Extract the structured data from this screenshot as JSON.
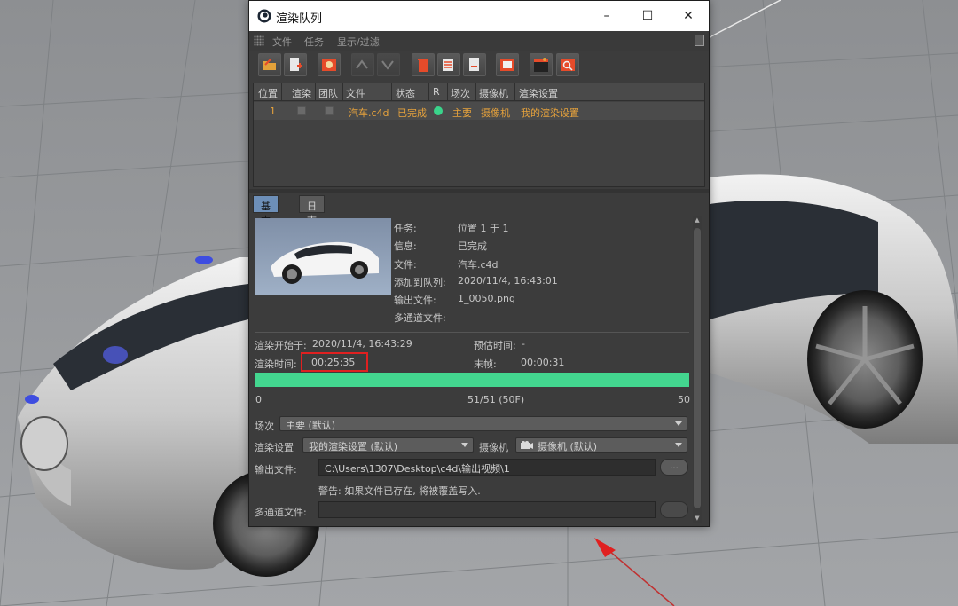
{
  "window": {
    "title": "渲染队列",
    "minimize": "–",
    "maximize": "☐",
    "close": "✕"
  },
  "menu": [
    "文件",
    "任务",
    "显示/过滤"
  ],
  "toolbar": {
    "icons": [
      "open-folder-icon",
      "add-file-icon",
      "render-icon",
      "toggle-icon-1",
      "toggle-icon-2",
      "delete-icon",
      "edit-list-icon",
      "new-doc-icon",
      "picture-viewer-icon",
      "clapper-icon",
      "render-view-icon"
    ]
  },
  "queue": {
    "headers": [
      "位置",
      "渲染",
      "团队",
      "文件",
      "状态",
      "R",
      "场次",
      "摄像机",
      "渲染设置"
    ],
    "rows": [
      {
        "position": "1",
        "file": "汽车.c4d",
        "status": "已完成",
        "take": "主要",
        "camera": "摄像机",
        "render_setting": "我的渲染设置"
      }
    ]
  },
  "tabs": {
    "basic": "基本",
    "log": "日志文件"
  },
  "info": {
    "labels": [
      "任务:",
      "信息:",
      "文件:",
      "添加到队列:",
      "输出文件:",
      "多通道文件:"
    ],
    "values": [
      "位置 1 于 1",
      "已完成",
      "汽车.c4d",
      "2020/11/4, 16:43:01",
      "1_0050.png",
      ""
    ]
  },
  "stats": {
    "start_label": "渲染开始于:",
    "start_value": "2020/11/4, 16:43:29",
    "estimate_label": "预估时间:",
    "estimate_value": "-",
    "time_label": "渲染时间:",
    "time_value": "00:25:35",
    "last_label": "末帧:",
    "last_value": "00:00:31"
  },
  "progress": {
    "fraction": 1.0,
    "min": "0",
    "label": "51/51 (50F)",
    "max": "50"
  },
  "settings": {
    "take_label": "场次",
    "take_value": "主要 (默认)",
    "render_label": "渲染设置",
    "render_value": "我的渲染设置 (默认)",
    "camera_label": "摄像机",
    "camera_value": "摄像机 (默认)",
    "output_label": "输出文件:",
    "output_value": "C:\\Users\\1307\\Desktop\\c4d\\输出视频\\1",
    "browse": "...",
    "warning": "警告: 如果文件已存在, 将被覆盖写入.",
    "multipass_label": "多通道文件:",
    "multipass_value": ""
  },
  "colors": {
    "accent_orange": "#e6a23c",
    "status_green": "#3ad48b",
    "progress_green": "#43d68f",
    "tab_blue": "#6d8fb8",
    "highlight_red": "#e02020"
  }
}
